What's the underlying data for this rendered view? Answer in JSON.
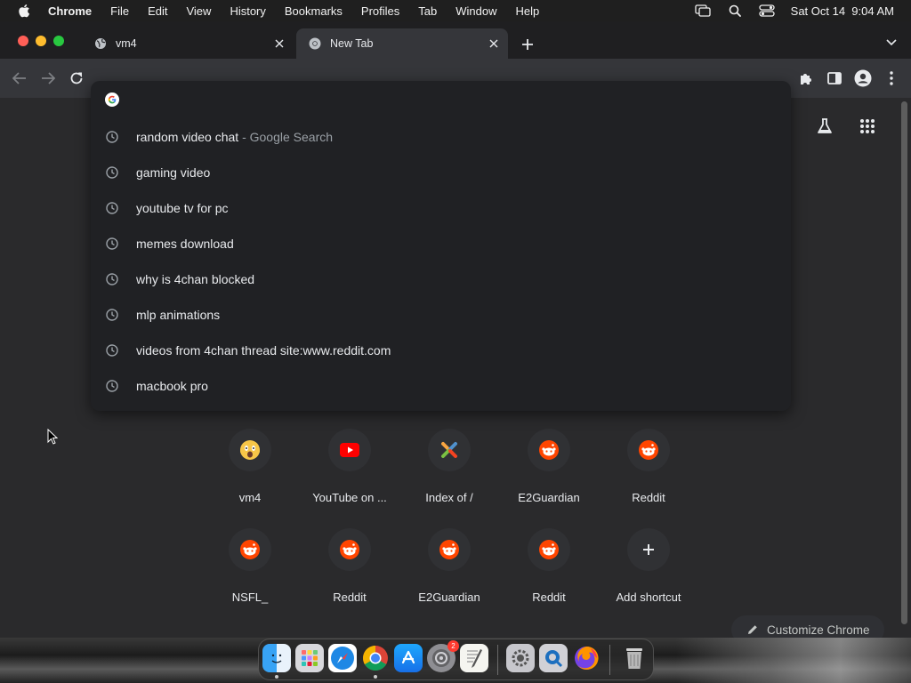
{
  "menubar": {
    "app_name": "Chrome",
    "items": [
      "File",
      "Edit",
      "View",
      "History",
      "Bookmarks",
      "Profiles",
      "Tab",
      "Window",
      "Help"
    ],
    "datetime": "Sat Oct 14  9:04 AM"
  },
  "tabs": [
    {
      "title": "vm4",
      "icon": "globe-icon",
      "active": false
    },
    {
      "title": "New Tab",
      "icon": "chrome-icon",
      "active": true
    }
  ],
  "omnibox": {
    "value": "",
    "suggestions": [
      {
        "text": "random video chat",
        "suffix": " - Google Search"
      },
      {
        "text": "gaming video",
        "suffix": ""
      },
      {
        "text": "youtube tv for pc",
        "suffix": ""
      },
      {
        "text": "memes download",
        "suffix": ""
      },
      {
        "text": "why is 4chan blocked",
        "suffix": ""
      },
      {
        "text": "mlp animations",
        "suffix": ""
      },
      {
        "text": "videos from 4chan thread site:www.reddit.com",
        "suffix": ""
      },
      {
        "text": "macbook pro",
        "suffix": ""
      }
    ]
  },
  "shortcuts": [
    {
      "label": "vm4",
      "icon": "vm4-emoji-icon"
    },
    {
      "label": "YouTube on ...",
      "icon": "youtube-icon"
    },
    {
      "label": "Index of /",
      "icon": "joomla-icon"
    },
    {
      "label": "E2Guardian",
      "icon": "reddit-icon"
    },
    {
      "label": "Reddit",
      "icon": "reddit-icon"
    },
    {
      "label": "NSFL_",
      "icon": "reddit-icon"
    },
    {
      "label": "Reddit",
      "icon": "reddit-icon"
    },
    {
      "label": "E2Guardian",
      "icon": "reddit-icon"
    },
    {
      "label": "Reddit",
      "icon": "reddit-icon"
    },
    {
      "label": "Add shortcut",
      "icon": "plus-icon"
    }
  ],
  "customize_label": "Customize Chrome",
  "dock": {
    "items": [
      "finder-icon",
      "launchpad-icon",
      "safari-icon",
      "chrome-icon",
      "app-store-icon",
      "system-preferences-icon",
      "textedit-icon",
      "system-settings-icon",
      "quicktime-icon",
      "firefox-icon",
      "trash-icon"
    ],
    "badge": "2"
  },
  "colors": {
    "accent_reddit": "#ff4500",
    "youtube_red": "#ff0000",
    "close_red": "#ff5f57",
    "minimize_yellow": "#febc2e",
    "zoom_green": "#28c840"
  }
}
